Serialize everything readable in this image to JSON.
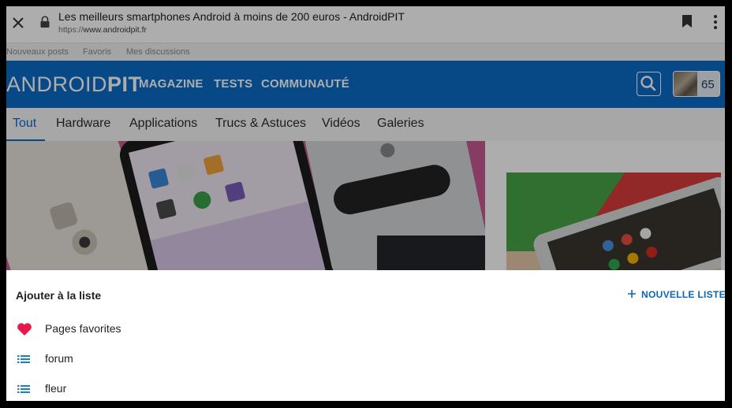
{
  "browser": {
    "title": "Les meilleurs smartphones Android à moins de 200 euros - AndroidPIT",
    "url_scheme": "https://",
    "url_host": "www.androidpit.fr"
  },
  "site": {
    "topbar": [
      "Nouveaux posts",
      "Favoris",
      "Mes discussions"
    ],
    "logo_light": "ANDROID",
    "logo_bold": "PIT",
    "main_nav": [
      "MAGAZINE",
      "TESTS",
      "COMMUNAUTÉ"
    ],
    "user_count": "65",
    "tabs": [
      "Tout",
      "Hardware",
      "Applications",
      "Trucs & Astuces",
      "Vidéos",
      "Galeries"
    ],
    "active_tab": "Tout",
    "brand_color": "#0a6cc6"
  },
  "sheet": {
    "heading": "Ajouter à la liste",
    "new_list_label": "NOUVELLE LISTE",
    "items": [
      {
        "label": "Pages favorites",
        "icon": "heart-icon"
      },
      {
        "label": "forum",
        "icon": "list-icon"
      },
      {
        "label": "fleur",
        "icon": "list-icon"
      }
    ],
    "accent_color": "#0b66b6",
    "favorite_color": "#e8174a"
  }
}
